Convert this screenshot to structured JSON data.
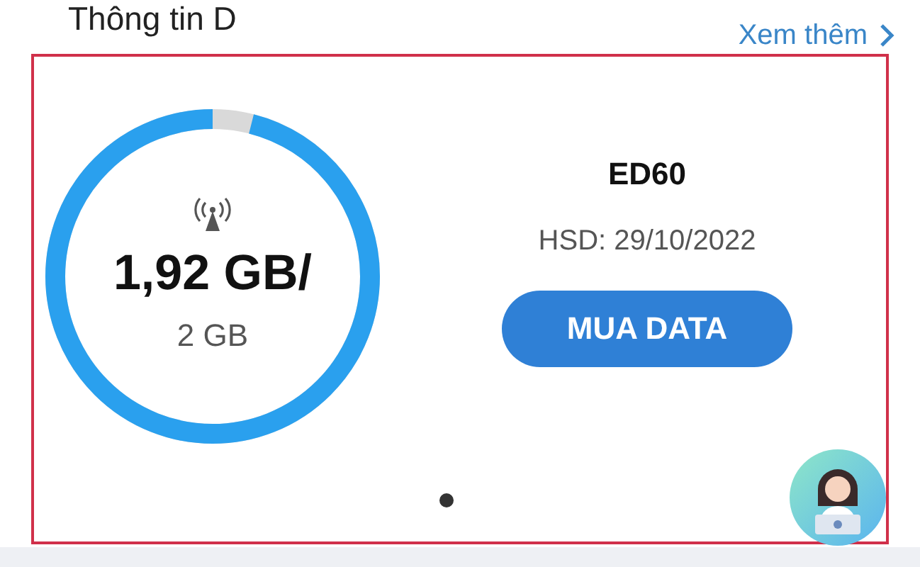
{
  "header": {
    "title": "Thông tin D",
    "more_link": "Xem thêm"
  },
  "usage": {
    "used": "1,92 GB/",
    "total": "2 GB"
  },
  "package": {
    "name": "ED60",
    "expiry": "HSD: 29/10/2022",
    "button": "MUA DATA"
  },
  "pager": [
    {
      "selected": true
    }
  ]
}
